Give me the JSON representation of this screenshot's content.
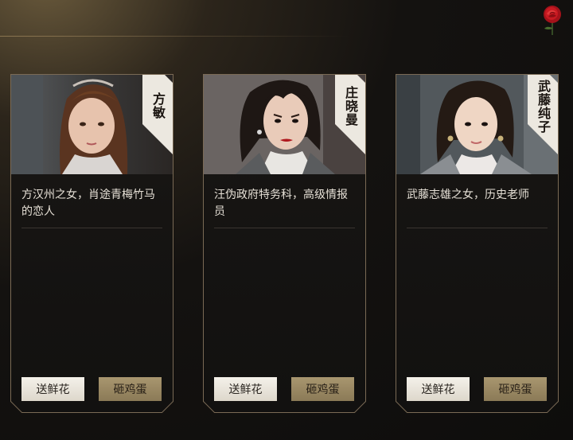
{
  "decor": {
    "rose_icon": "rose-icon"
  },
  "accent_colors": {
    "frame": "#7a6a55",
    "tab": "#e9e4da",
    "flower_button": "#efebe3",
    "egg_button": "#9a8864"
  },
  "cards": [
    {
      "name": "方敏",
      "description": "方汉州之女，肖途青梅竹马的恋人",
      "flower_label": "送鲜花",
      "egg_label": "砸鸡蛋"
    },
    {
      "name": "庄晓曼",
      "description": "汪伪政府特务科，高级情报员",
      "flower_label": "送鲜花",
      "egg_label": "砸鸡蛋"
    },
    {
      "name": "武藤纯子",
      "description": "武藤志雄之女，历史老师",
      "flower_label": "送鲜花",
      "egg_label": "砸鸡蛋"
    }
  ]
}
